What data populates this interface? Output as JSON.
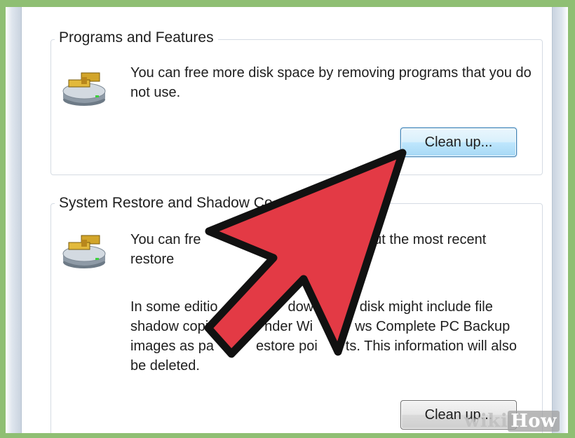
{
  "programs_features": {
    "title": "Programs and Features",
    "description": "You can free more disk space by removing programs that you do not use.",
    "cleanup_label": "Clean up..."
  },
  "system_restore": {
    "title": "System Restore and Shadow Co",
    "description_1": "You can fre       moving all but the most recent restore",
    "description_2": "In some editio     dow    disk might include file shadow copi    nder Wi   ws Complete PC Backup images as pa   estore poi  ts. This information will also be deleted.",
    "cleanup_label": "Clean up..."
  },
  "icons": {
    "drive": "hard-drive-icon",
    "arrow": "red-arrow-pointer"
  },
  "colors": {
    "arrow_fill": "#e33a45",
    "focus_border": "#3c7fb1",
    "background": "#8fbf73"
  },
  "watermark": {
    "prefix": "wiki",
    "suffix": "How"
  }
}
